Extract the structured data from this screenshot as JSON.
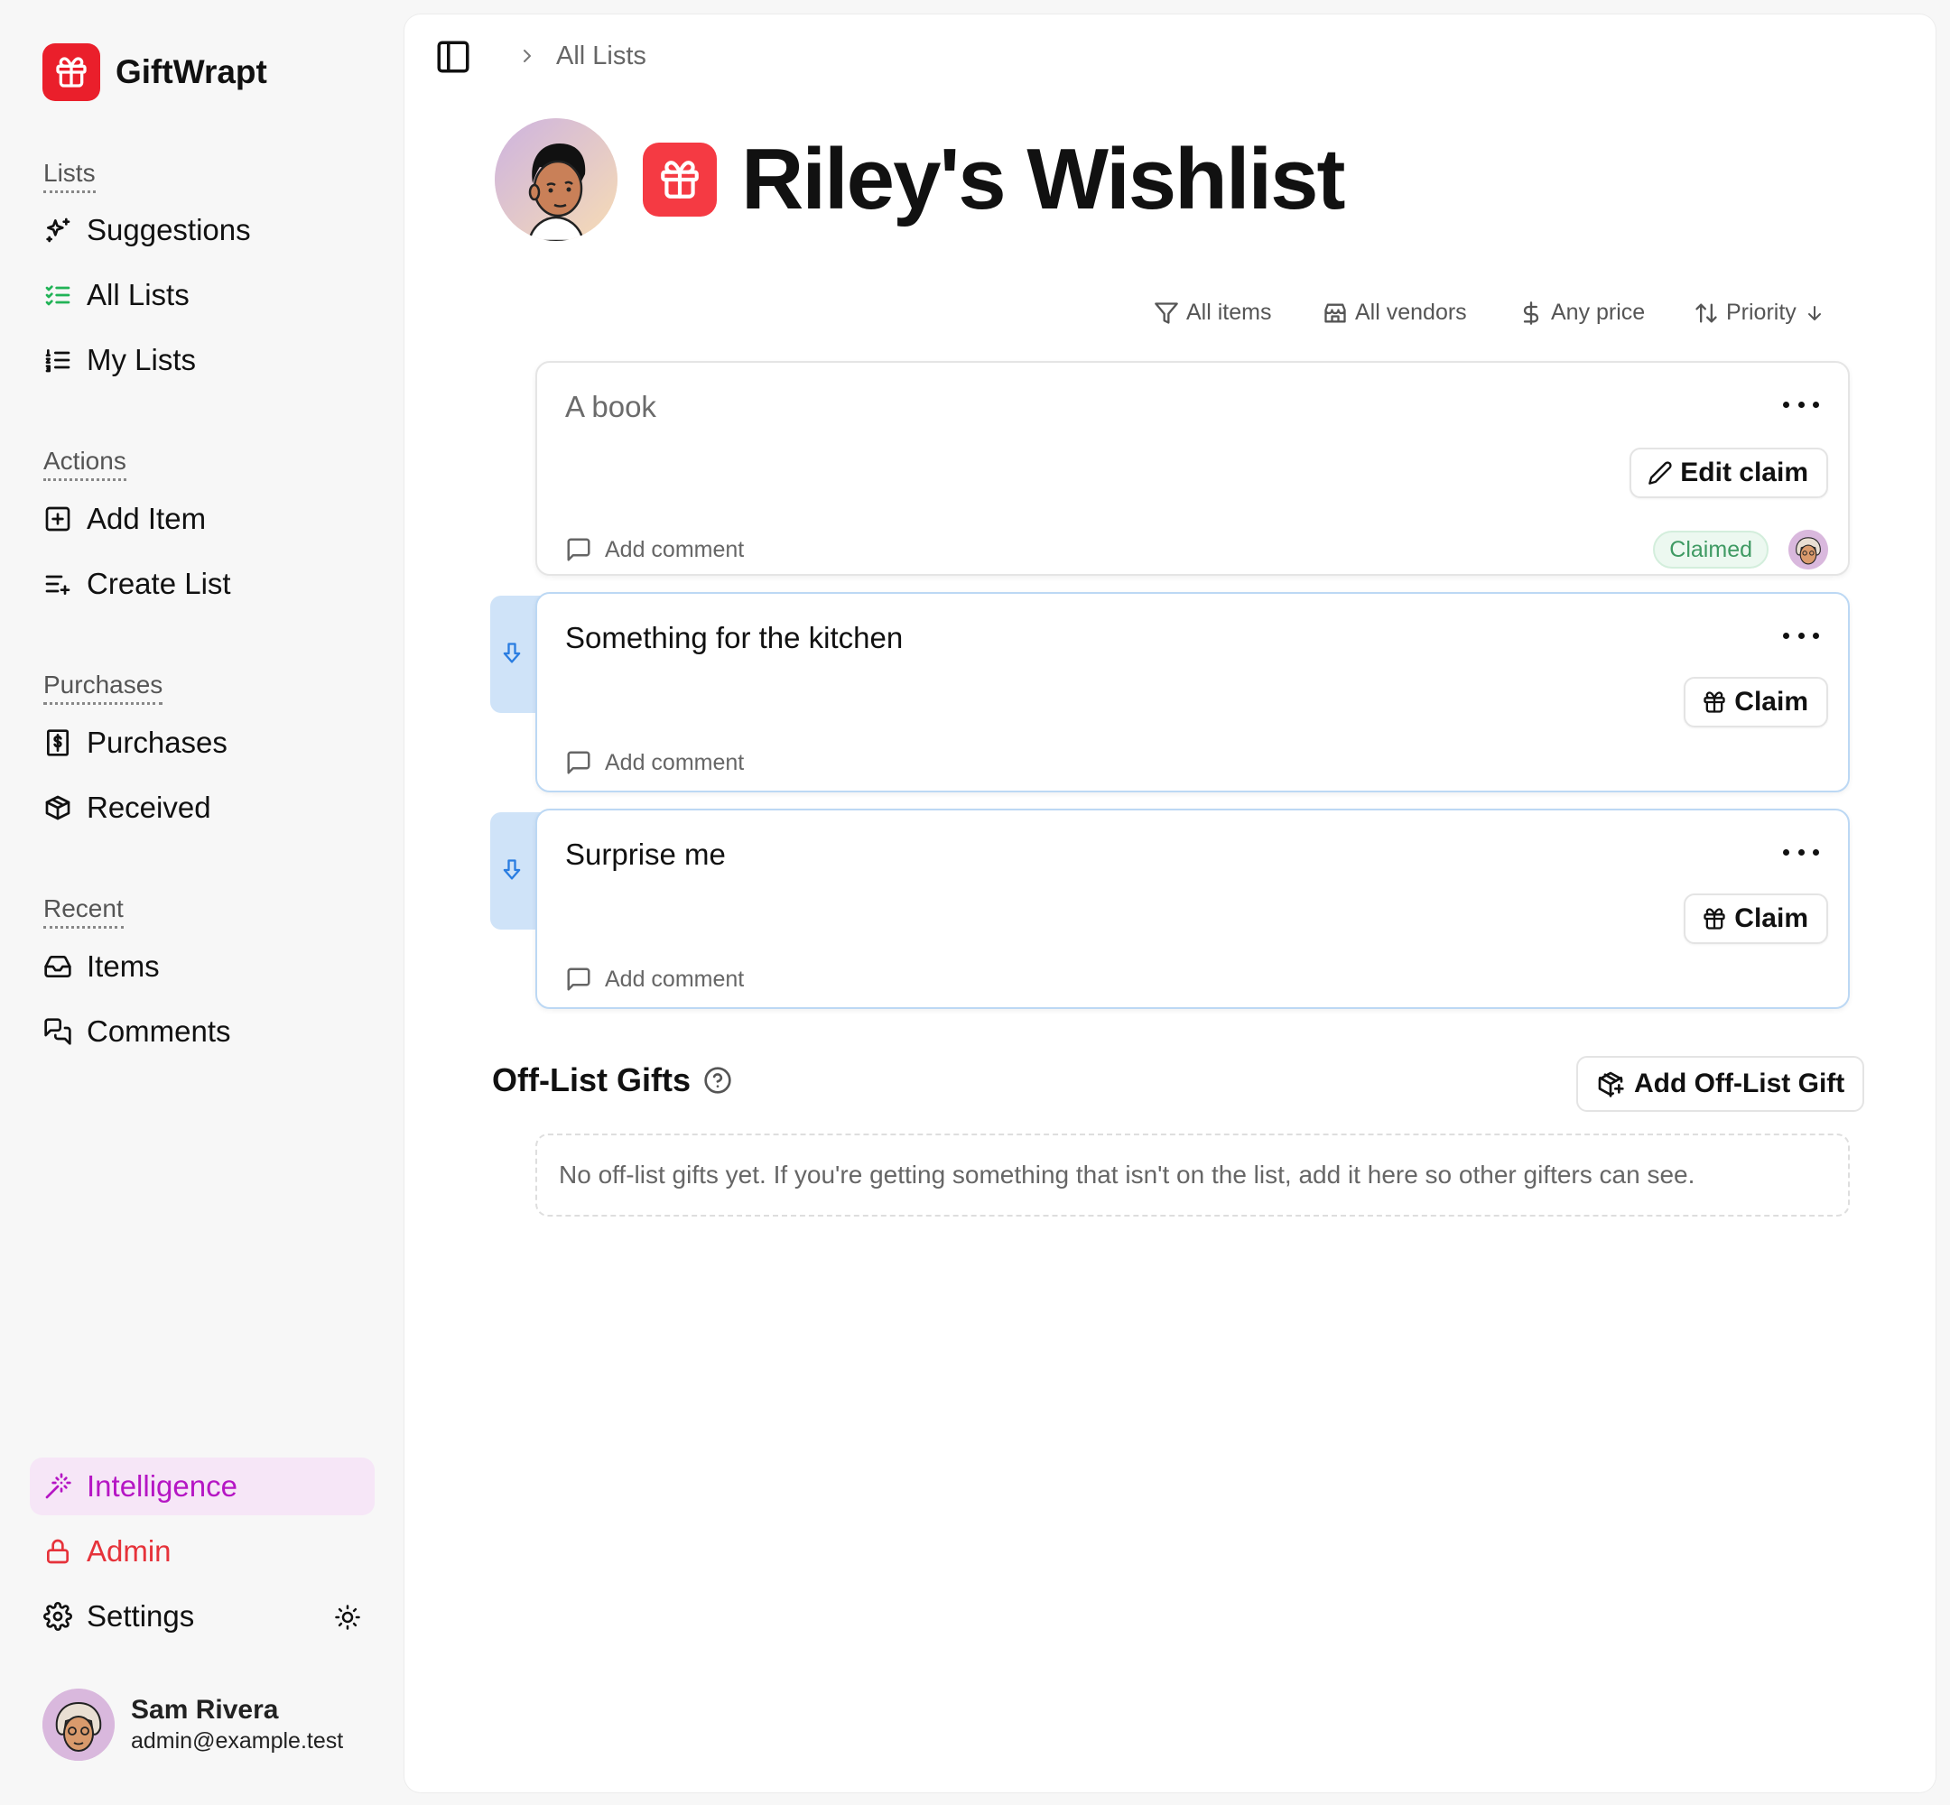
{
  "app": {
    "name": "GiftWrapt"
  },
  "sidebar": {
    "sections": {
      "lists": "Lists",
      "actions": "Actions",
      "purchases": "Purchases",
      "recent": "Recent"
    },
    "items": {
      "suggestions": "Suggestions",
      "all_lists": "All Lists",
      "my_lists": "My Lists",
      "add_item": "Add Item",
      "create_list": "Create List",
      "purchases": "Purchases",
      "received": "Received",
      "items": "Items",
      "comments": "Comments",
      "intelligence": "Intelligence",
      "admin": "Admin",
      "settings": "Settings"
    },
    "user": {
      "name": "Sam Rivera",
      "email": "admin@example.test"
    }
  },
  "breadcrumb": {
    "current": "All Lists"
  },
  "page": {
    "title": "Riley's Wishlist"
  },
  "filters": {
    "items": "All items",
    "vendors": "All vendors",
    "price": "Any price",
    "sort": "Priority"
  },
  "list_items": [
    {
      "title": "A book",
      "action": "Edit claim",
      "comment": "Add comment",
      "status": "Claimed"
    },
    {
      "title": "Something for the kitchen",
      "action": "Claim",
      "comment": "Add comment"
    },
    {
      "title": "Surprise me",
      "action": "Claim",
      "comment": "Add comment"
    }
  ],
  "offlist": {
    "heading": "Off-List Gifts",
    "button": "Add Off-List Gift",
    "empty": "No off-list gifts yet. If you're getting something that isn't on the list, add it here so other gifters can see."
  },
  "colors": {
    "brand": "#ea1f2b",
    "intelligence": "#b516c4",
    "admin": "#e6323a",
    "claimed": "#3f9a63",
    "accent_blue": "#2a7de1"
  }
}
